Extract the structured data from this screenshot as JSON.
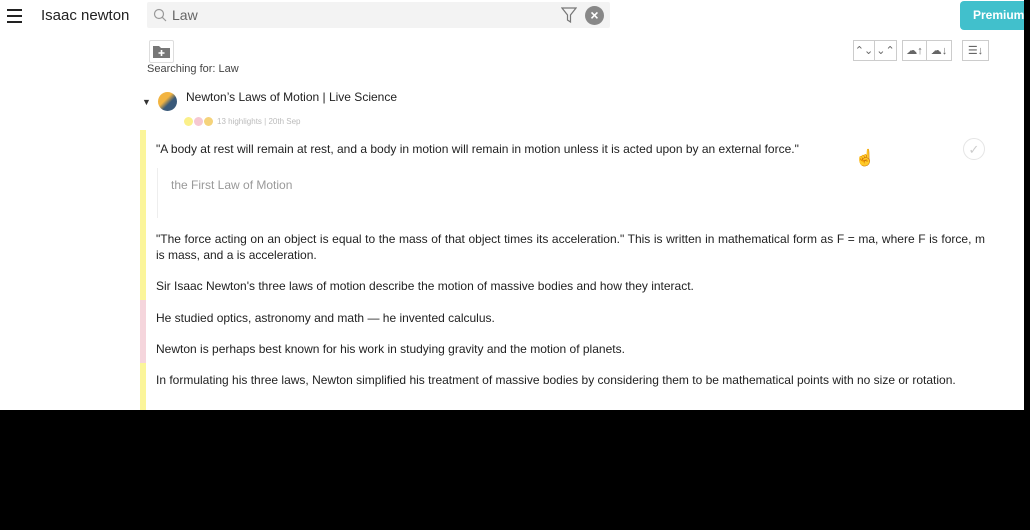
{
  "header": {
    "title": "Isaac newton",
    "search_value": "Law",
    "premium_label": "Premium"
  },
  "searching_label": "Searching for: Law",
  "toolbar": {
    "icons": [
      "expand-icon",
      "collapse-icon",
      "cloud-upload-icon",
      "cloud-download-icon",
      "sort-icon"
    ]
  },
  "document": {
    "title": "Newton’s Laws of Motion | Live Science",
    "meta": "13 highlights | 20th Sep",
    "dot_colors": [
      "#fbf08a",
      "#f5c8d2",
      "#f5d37a"
    ]
  },
  "highlights": [
    {
      "text": "\"A body at rest will remain at rest, and a body in motion will remain in motion unless it is acted upon by an external force.\"",
      "color": "#fbf59a",
      "note": "the First Law of Motion"
    },
    {
      "text": "\"The force acting on an object is equal to the mass of that object times its acceleration.\" This is written in mathematical form as F = ma, where F is force, m is mass, and a is acceleration.",
      "color": "#fbf59a"
    },
    {
      "text": "Sir Isaac Newton's three laws of motion describe the motion of massive bodies and how they interact.",
      "color": "#fbf59a"
    },
    {
      "text": "He studied optics, astronomy and math — he invented calculus.",
      "color": "#f5d5dc"
    },
    {
      "text": "Newton is perhaps best known for his work in studying gravity and the motion of planets.",
      "color": "#f5d5dc"
    },
    {
      "text": "In formulating his three laws, Newton simplified his treatment of massive bodies by considering them to be mathematical points with no size or rotation.",
      "color": "#fbf59a"
    }
  ]
}
